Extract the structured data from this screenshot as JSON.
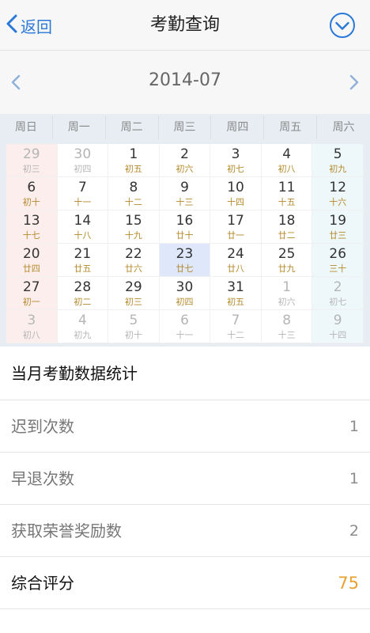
{
  "header": {
    "back_label": "返回",
    "title": "考勤查询"
  },
  "month_nav": {
    "label": "2014-07"
  },
  "weekdays": [
    "周日",
    "周一",
    "周二",
    "周三",
    "周四",
    "周五",
    "周六"
  ],
  "calendar": {
    "rows": [
      [
        {
          "day": "29",
          "lunar": "初三",
          "other": true
        },
        {
          "day": "30",
          "lunar": "初四",
          "other": true
        },
        {
          "day": "1",
          "lunar": "初五"
        },
        {
          "day": "2",
          "lunar": "初六"
        },
        {
          "day": "3",
          "lunar": "初七"
        },
        {
          "day": "4",
          "lunar": "初八"
        },
        {
          "day": "5",
          "lunar": "初九"
        }
      ],
      [
        {
          "day": "6",
          "lunar": "初十"
        },
        {
          "day": "7",
          "lunar": "十一"
        },
        {
          "day": "8",
          "lunar": "十二"
        },
        {
          "day": "9",
          "lunar": "十三"
        },
        {
          "day": "10",
          "lunar": "十四"
        },
        {
          "day": "11",
          "lunar": "十五"
        },
        {
          "day": "12",
          "lunar": "十六"
        }
      ],
      [
        {
          "day": "13",
          "lunar": "十七"
        },
        {
          "day": "14",
          "lunar": "十八"
        },
        {
          "day": "15",
          "lunar": "十九"
        },
        {
          "day": "16",
          "lunar": "廿十"
        },
        {
          "day": "17",
          "lunar": "廿一"
        },
        {
          "day": "18",
          "lunar": "廿二"
        },
        {
          "day": "19",
          "lunar": "廿三"
        }
      ],
      [
        {
          "day": "20",
          "lunar": "廿四"
        },
        {
          "day": "21",
          "lunar": "廿五"
        },
        {
          "day": "22",
          "lunar": "廿六"
        },
        {
          "day": "23",
          "lunar": "廿七",
          "today": true
        },
        {
          "day": "24",
          "lunar": "廿八"
        },
        {
          "day": "25",
          "lunar": "廿九"
        },
        {
          "day": "26",
          "lunar": "三十"
        }
      ],
      [
        {
          "day": "27",
          "lunar": "初一"
        },
        {
          "day": "28",
          "lunar": "初二"
        },
        {
          "day": "29",
          "lunar": "初三"
        },
        {
          "day": "30",
          "lunar": "初四"
        },
        {
          "day": "31",
          "lunar": "初五"
        },
        {
          "day": "1",
          "lunar": "初六",
          "other": true
        },
        {
          "day": "2",
          "lunar": "初七",
          "other": true
        }
      ],
      [
        {
          "day": "3",
          "lunar": "初八",
          "other": true
        },
        {
          "day": "4",
          "lunar": "初九",
          "other": true
        },
        {
          "day": "5",
          "lunar": "初十",
          "other": true
        },
        {
          "day": "6",
          "lunar": "十一",
          "other": true
        },
        {
          "day": "7",
          "lunar": "十二",
          "other": true
        },
        {
          "day": "8",
          "lunar": "十三",
          "other": true
        },
        {
          "day": "9",
          "lunar": "十四",
          "other": true
        }
      ]
    ]
  },
  "stats": {
    "title": "当月考勤数据统计",
    "late_label": "迟到次数",
    "late_value": "1",
    "early_label": "早退次数",
    "early_value": "1",
    "honor_label": "获取荣誉奖励数",
    "honor_value": "2",
    "score_label": "综合评分",
    "score_value": "75"
  },
  "colors": {
    "accent": "#2a78d8",
    "lunar": "#b48a2c",
    "score": "#e7a12f"
  },
  "icons": {
    "back": "chevron-left-icon",
    "confirm": "check-circle-icon",
    "prev": "chevron-left-icon",
    "next": "chevron-right-icon"
  }
}
